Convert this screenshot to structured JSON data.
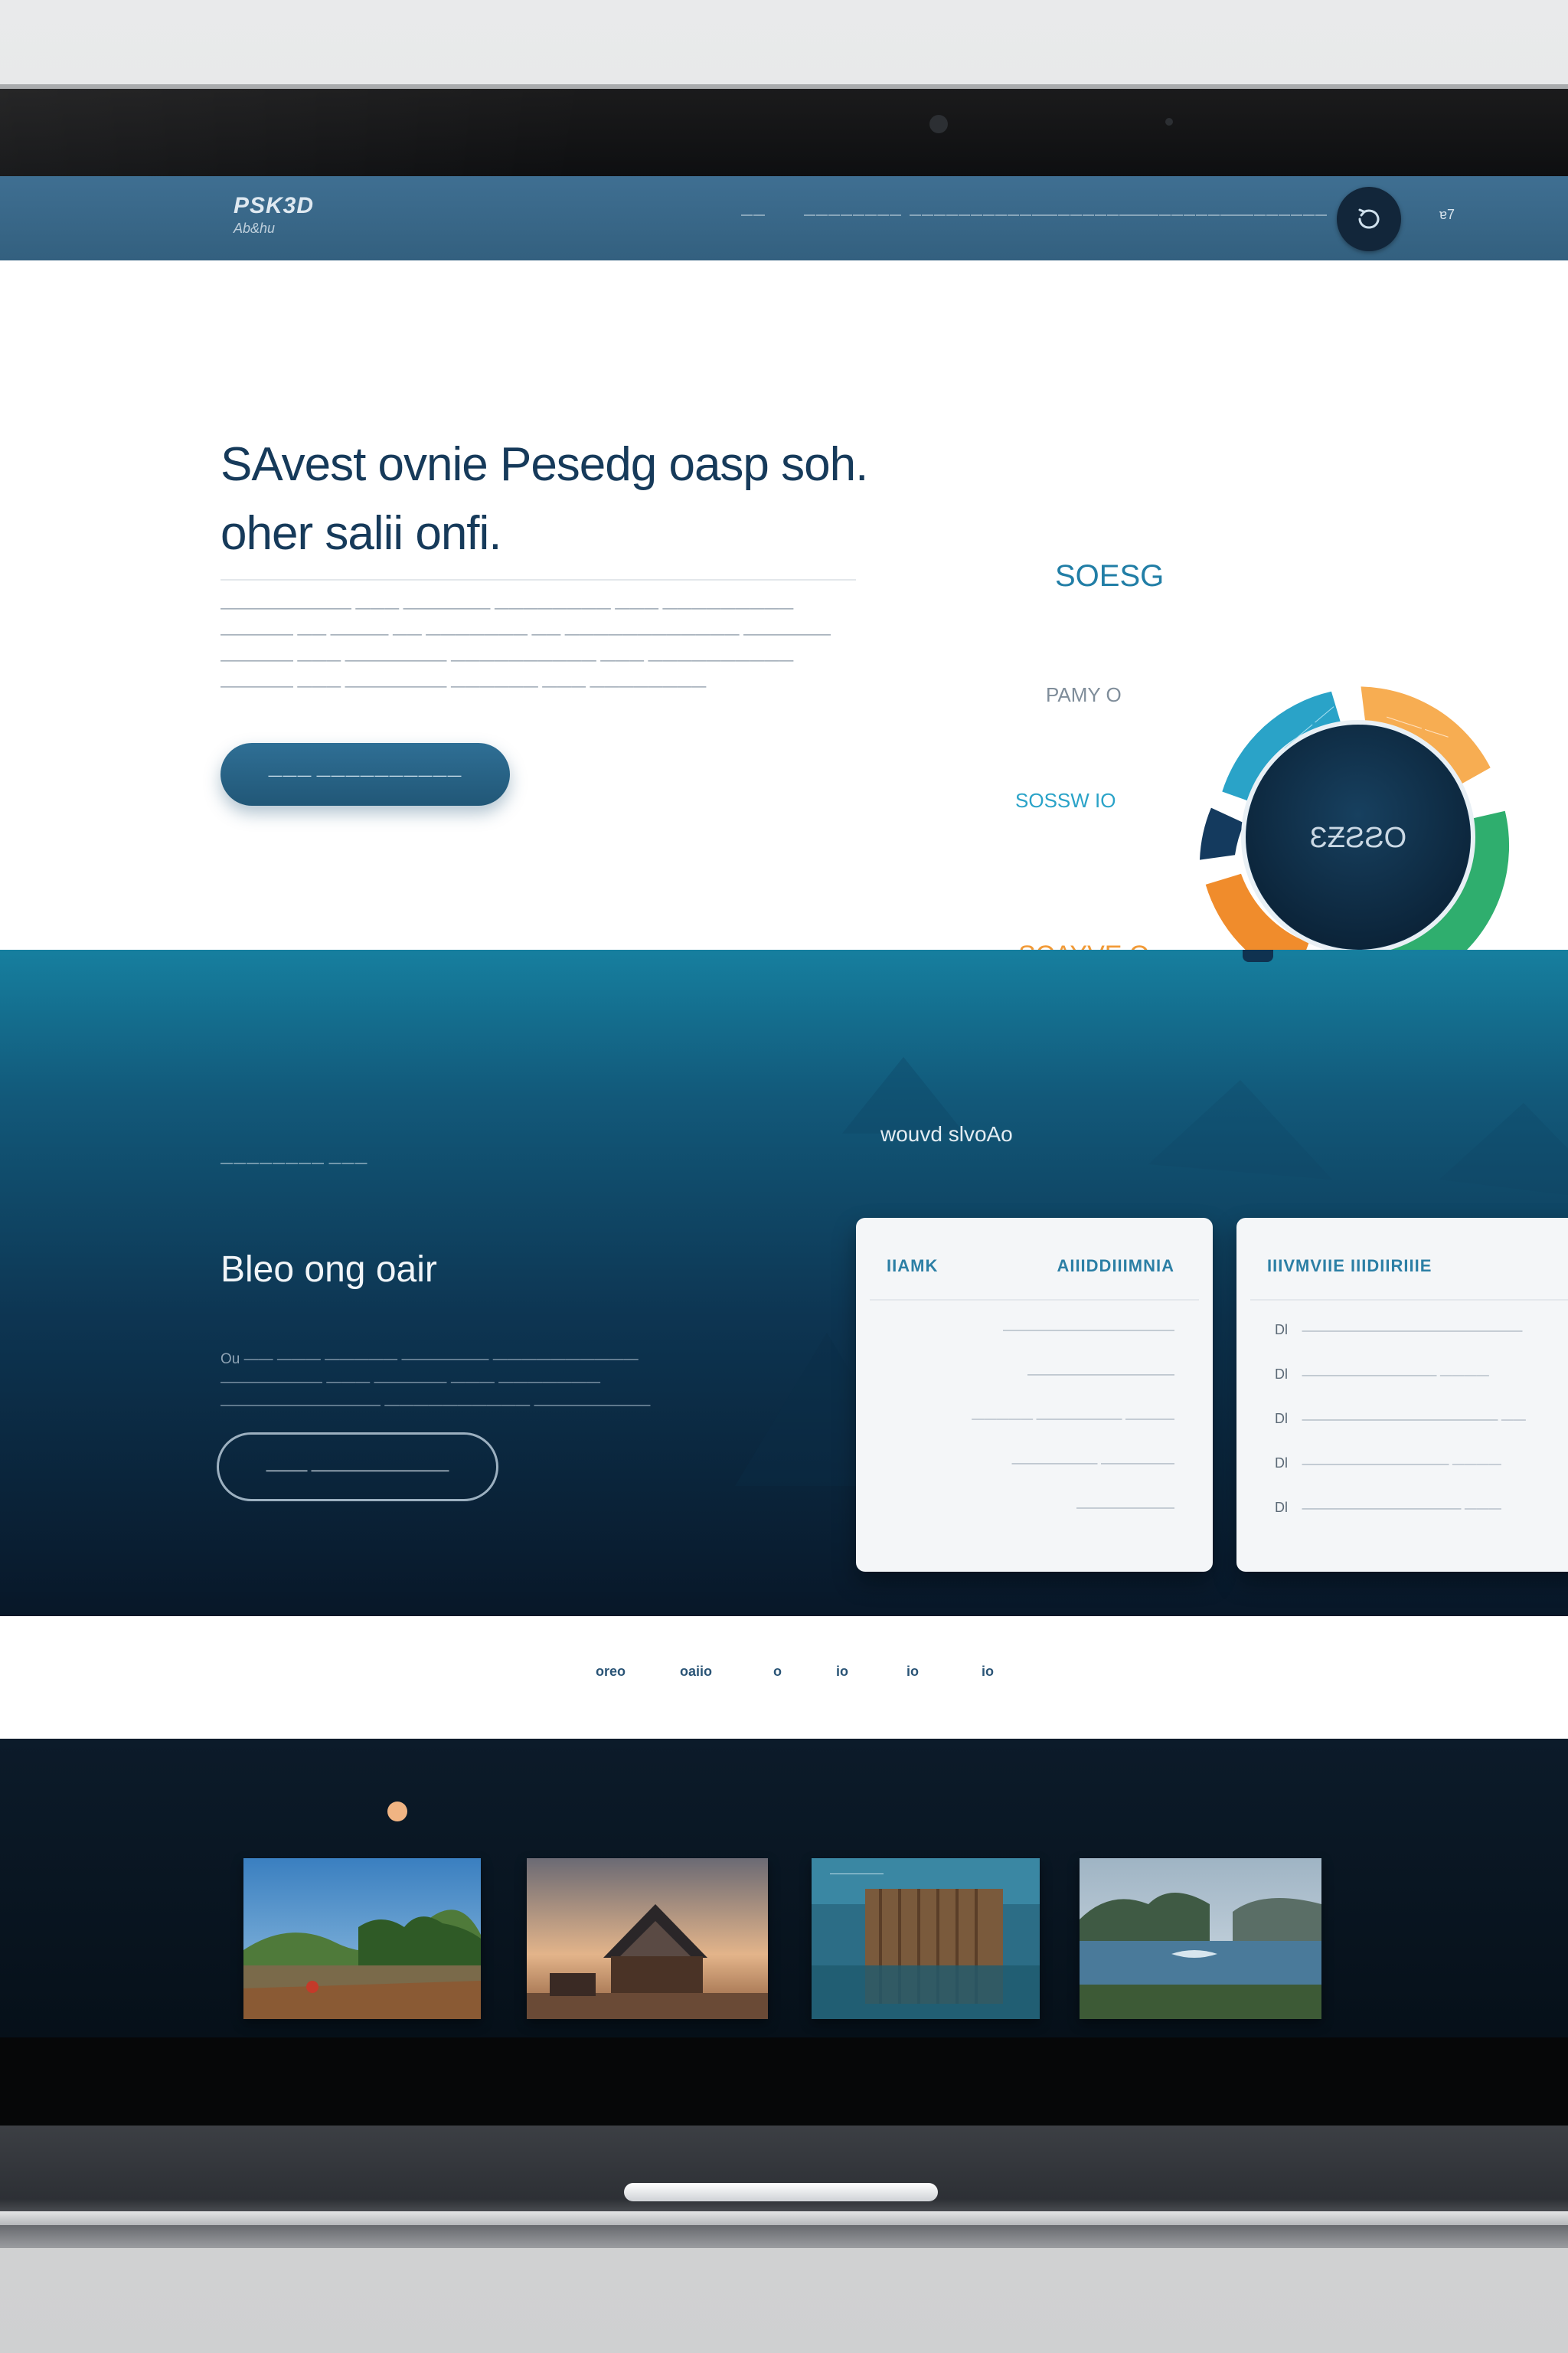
{
  "nav": {
    "logo_line1": "PSK3D",
    "logo_line2": "Ab&hu",
    "items": [
      "——",
      "————————",
      "————————————",
      "——————————",
      "——————————",
      "————————"
    ],
    "end_label": "ɐ7"
  },
  "hero": {
    "title_line1": "SAvest ovnie Pesedg oasp soh.",
    "title_line2": "oher salii onfi.",
    "description": "————————— ——— —————— ———————— ——— ————————— ————— —— ———— —— ——————— —— ———————————— —————— ————— ——— ——————— —————————— ——— —————————— ————— ——— ——————— —————— ——— ————————",
    "cta_label": "——— ——————————"
  },
  "donut": {
    "center_label": "ƐƵƧƧO",
    "labels": {
      "top": "SOESG",
      "upper_left": "PAMY O",
      "middle_left": "SOSSW IO",
      "lower_left": "SCAYVE O"
    }
  },
  "features": {
    "eyebrow": "———————— ———",
    "title": "Bleo ong oair",
    "description": "Ou —— ——— ————— —————— —————————— ——————— ——— ————— ——— ——————— ——————————— —————————— ————————",
    "cta_label": "——— ——————————",
    "panels_title": "wouvd slvoAo",
    "card1": {
      "header_left": "IIAMK",
      "header_right": "AIIIDDIIIMNIA",
      "rows": [
        "——————————————",
        "————————————",
        "————— ——————— ————",
        "——————— ——————",
        "————————"
      ]
    },
    "card2": {
      "header": "IIIVMVIIE IIIDIIRIIIE",
      "row_glyphs": [
        "Dl",
        "Dl",
        "Dl",
        "Dl",
        "Dl"
      ],
      "rows": [
        "——————————————————",
        "——————————— ————",
        "———————————————— ——",
        "———————————— ————",
        "————————————— ———"
      ]
    }
  },
  "strip": {
    "items": [
      "oreo",
      "oaiio",
      "o",
      "io",
      "io",
      "io"
    ]
  },
  "colors": {
    "navbar": "#3a6a8c",
    "hero_title": "#163a5a",
    "accent_teal": "#2aa3c8",
    "accent_orange": "#f08c2c",
    "accent_green": "#2fae6e",
    "accent_light_orange": "#f7ad52",
    "donut_center": "#0f2e48"
  },
  "icons": {
    "nav_circle": "refresh-icon"
  }
}
